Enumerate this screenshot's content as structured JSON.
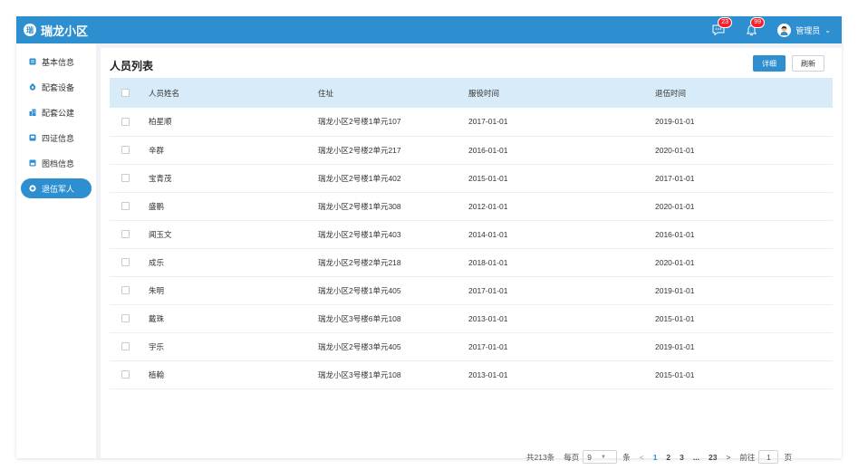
{
  "app": {
    "logo_text": "瑞",
    "title": "瑞龙小区"
  },
  "header": {
    "messages_badge": "23",
    "notifications_badge": "99",
    "user_name": "管理员",
    "user_chevron": "⌄"
  },
  "sidebar": {
    "items": [
      {
        "label": "基本信息",
        "icon": "list-icon"
      },
      {
        "label": "配套设备",
        "icon": "device-icon"
      },
      {
        "label": "配套公建",
        "icon": "building-icon"
      },
      {
        "label": "四证信息",
        "icon": "certificate-icon"
      },
      {
        "label": "图档信息",
        "icon": "archive-icon"
      },
      {
        "label": "退伍军人",
        "icon": "veteran-icon",
        "active": true
      }
    ]
  },
  "main": {
    "title": "人员列表",
    "detail_button": "详细",
    "refresh_button": "刷新",
    "columns": [
      "人员姓名",
      "住址",
      "服役时间",
      "退伍时间"
    ],
    "rows": [
      [
        "柏星顺",
        "瑞龙小区2号楼1单元107",
        "2017-01-01",
        "2019-01-01"
      ],
      [
        "辛群",
        "瑞龙小区2号楼2单元217",
        "2016-01-01",
        "2020-01-01"
      ],
      [
        "宝青茂",
        "瑞龙小区2号楼1单元402",
        "2015-01-01",
        "2017-01-01"
      ],
      [
        "盛鹏",
        "瑞龙小区2号楼1单元308",
        "2012-01-01",
        "2020-01-01"
      ],
      [
        "闻玉文",
        "瑞龙小区2号楼1单元403",
        "2014-01-01",
        "2016-01-01"
      ],
      [
        "成乐",
        "瑞龙小区2号楼2单元218",
        "2018-01-01",
        "2020-01-01"
      ],
      [
        "朱明",
        "瑞龙小区2号楼1单元405",
        "2017-01-01",
        "2019-01-01"
      ],
      [
        "戴珠",
        "瑞龙小区3号楼6单元108",
        "2013-01-01",
        "2015-01-01"
      ],
      [
        "宇乐",
        "瑞龙小区2号楼3单元405",
        "2017-01-01",
        "2019-01-01"
      ],
      [
        "植翰",
        "瑞龙小区3号楼1单元108",
        "2013-01-01",
        "2015-01-01"
      ]
    ]
  },
  "pagination": {
    "total": "共213条",
    "per_page_label": "每页",
    "per_page_value": "9",
    "per_page_unit": "条",
    "prev": "<",
    "pages": [
      "1",
      "2",
      "3",
      "...",
      "23"
    ],
    "next": ">",
    "goto_label": "前往",
    "goto_value": "1",
    "goto_unit": "页"
  },
  "colors": {
    "primary": "#2d8fd0",
    "header_row": "#d8ebf8",
    "badge": "#f5222d"
  }
}
